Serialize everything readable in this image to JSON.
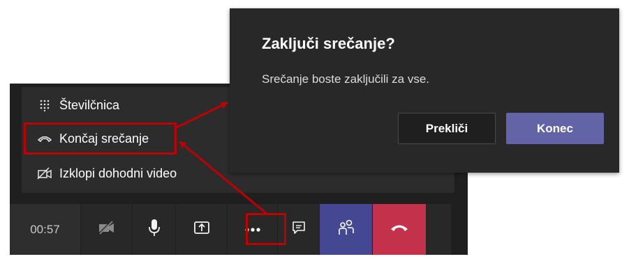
{
  "dialog": {
    "title": "Zaključi srečanje?",
    "message": "Srečanje boste zaključili za vse.",
    "cancel_label": "Prekliči",
    "end_label": "Konec"
  },
  "menu": {
    "items": [
      {
        "label": "Številčnica",
        "icon": "dialpad-icon"
      },
      {
        "label": "Končaj srečanje",
        "icon": "hang-up-icon"
      },
      {
        "label": "Izklopi dohodni video",
        "icon": "video-off-icon"
      }
    ]
  },
  "toolbar": {
    "timer": "00:57",
    "icons": [
      "camera-off-icon",
      "microphone-icon",
      "share-screen-icon",
      "more-options-icon",
      "chat-icon",
      "participants-icon",
      "hang-up-icon"
    ]
  },
  "colors": {
    "accent": "#6264a7",
    "hangup": "#c4314b",
    "annotation": "#c00000"
  }
}
